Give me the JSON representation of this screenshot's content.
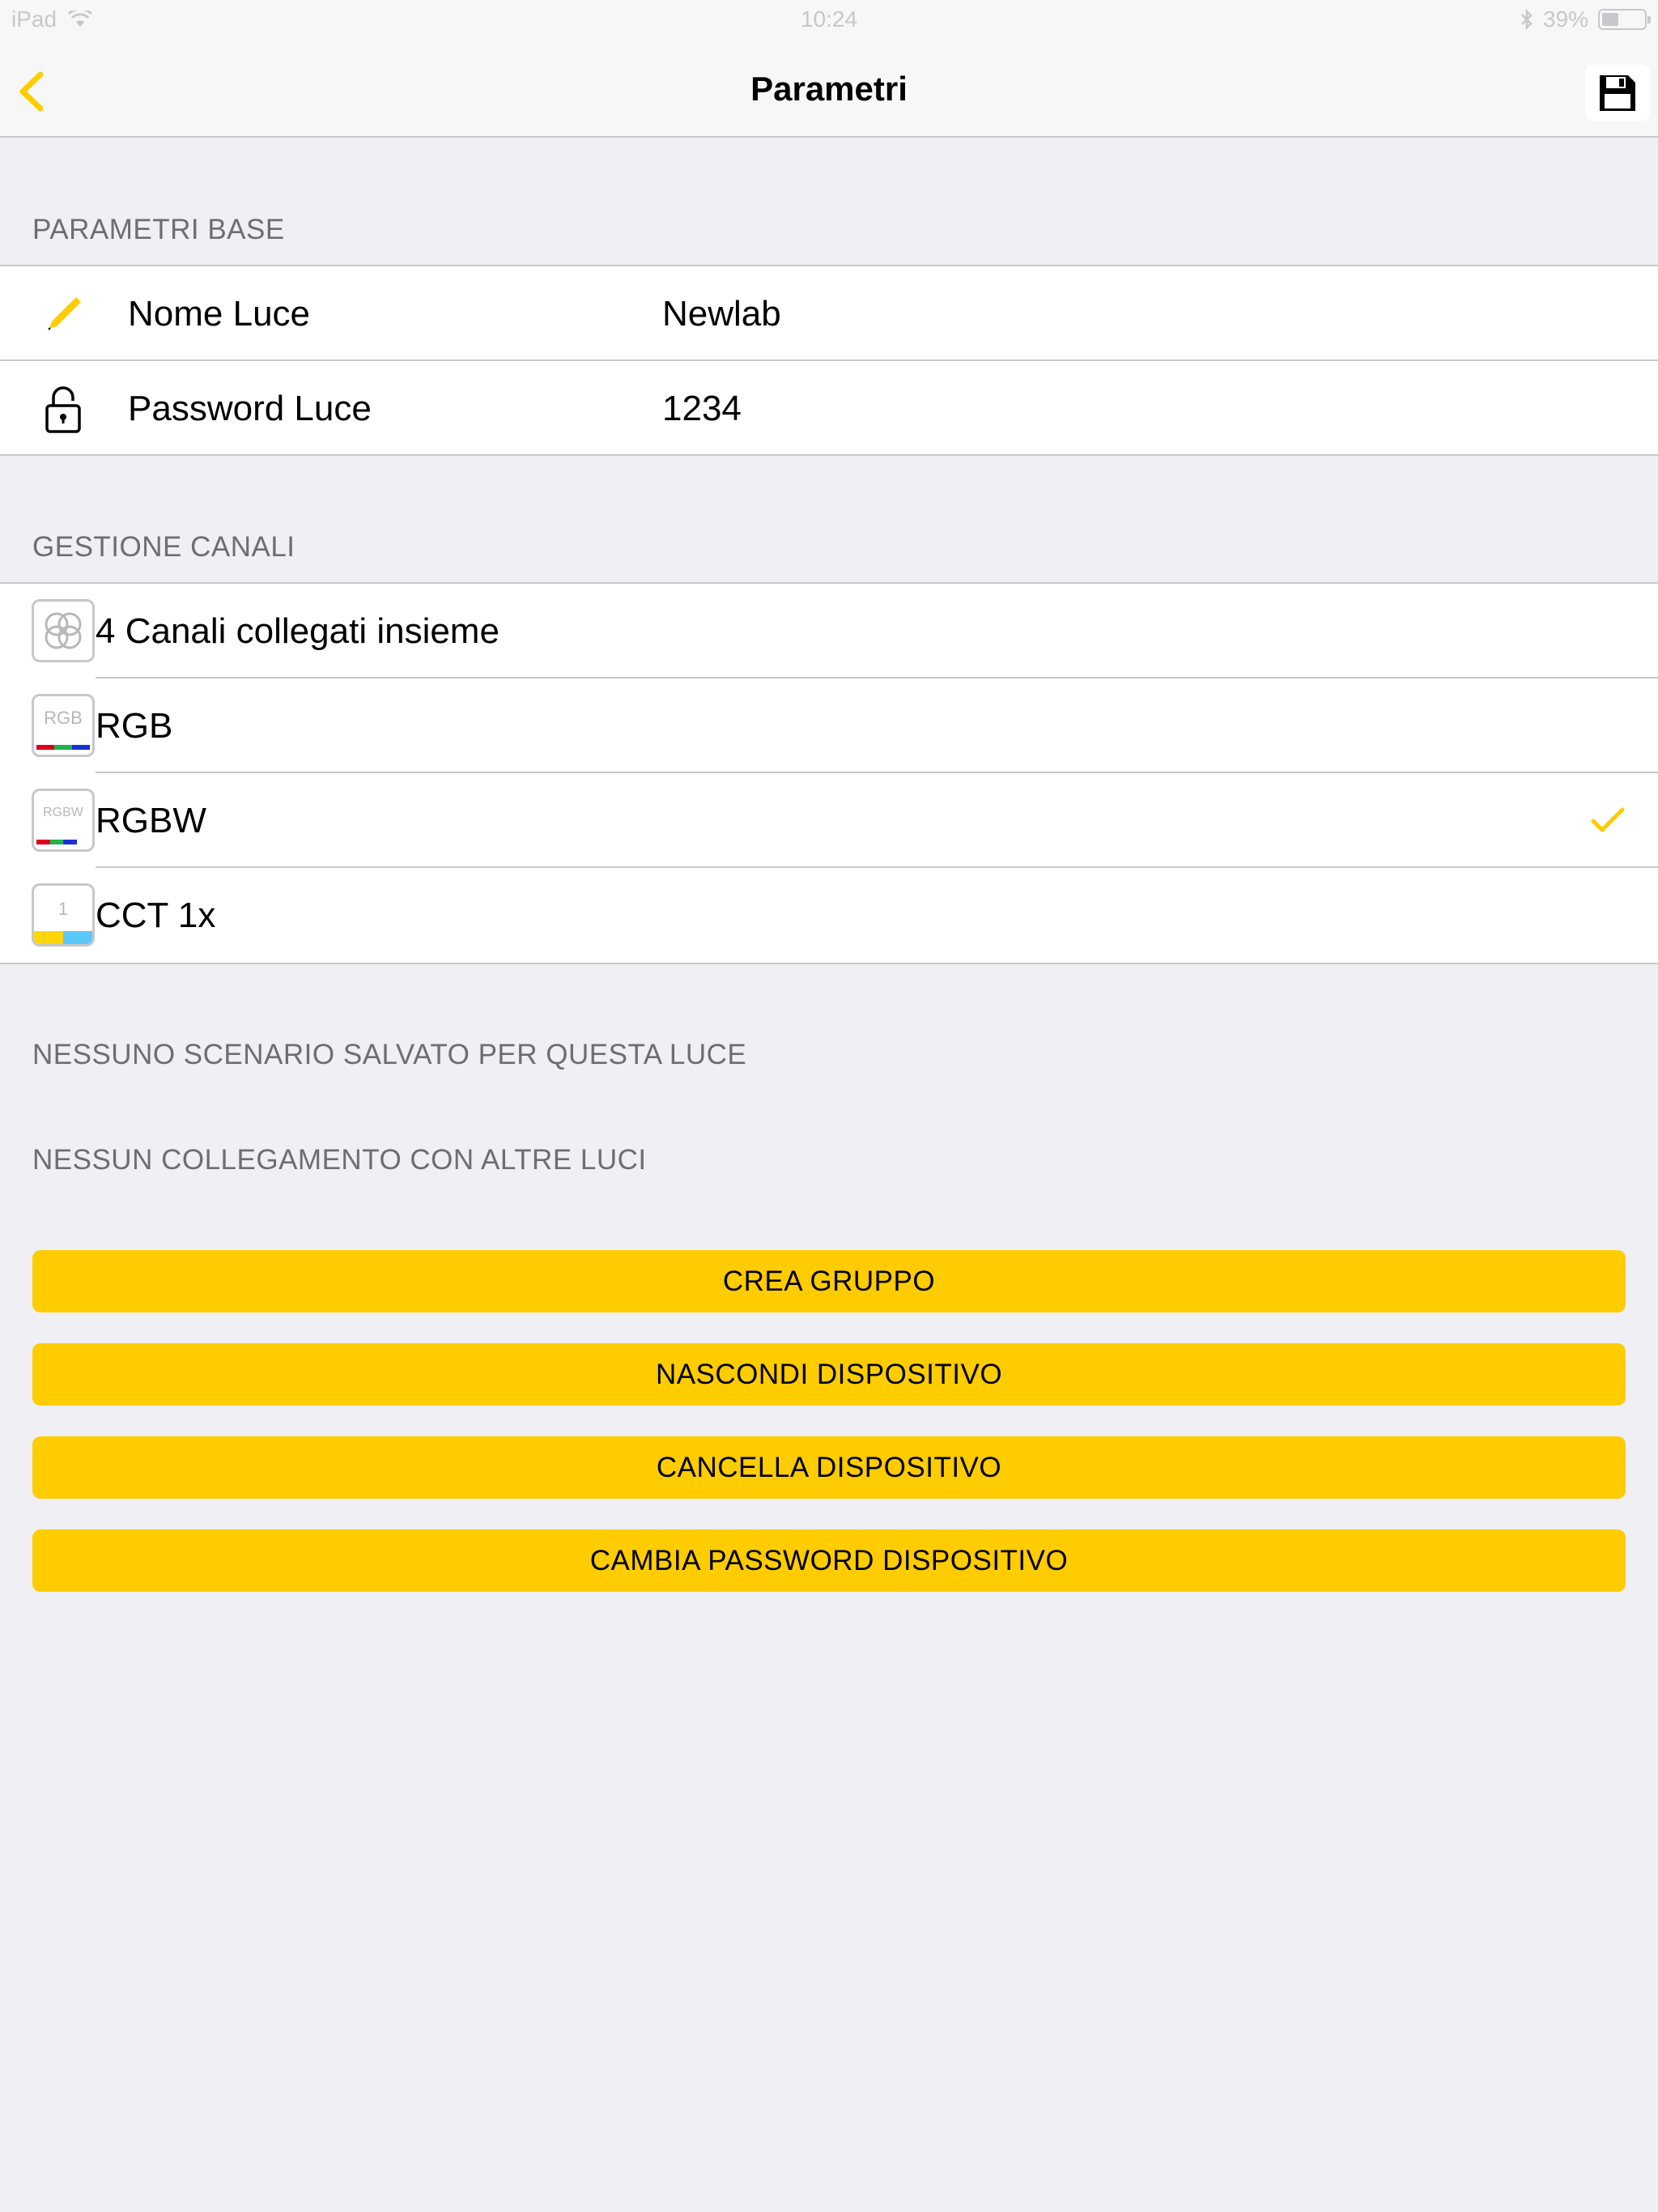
{
  "status_bar": {
    "device": "iPad",
    "time": "10:24",
    "battery_text": "39%",
    "battery_level": 0.39
  },
  "nav": {
    "title": "Parametri"
  },
  "base_params": {
    "header": "PARAMETRI BASE",
    "rows": [
      {
        "label": "Nome Luce",
        "value": "Newlab",
        "icon": "pencil-icon"
      },
      {
        "label": "Password Luce",
        "value": "1234",
        "icon": "lock-icon"
      }
    ]
  },
  "channels": {
    "header": "GESTIONE CANALI",
    "items": [
      {
        "label": "4 Canali collegati insieme",
        "icon": "linked-channels-icon",
        "selected": false
      },
      {
        "label": "RGB",
        "icon_text": "RGB",
        "icon": "rgb-icon",
        "selected": false
      },
      {
        "label": "RGBW",
        "icon_text": "RGBW",
        "icon": "rgbw-icon",
        "selected": true
      },
      {
        "label": "CCT 1x",
        "icon_text": "1",
        "icon": "cct-icon",
        "selected": false
      }
    ]
  },
  "info": {
    "no_scenario": "NESSUNO SCENARIO SALVATO PER QUESTA LUCE",
    "no_link": "NESSUN COLLEGAMENTO CON ALTRE LUCI"
  },
  "buttons": {
    "create_group": "CREA GRUPPO",
    "hide_device": "NASCONDI DISPOSITIVO",
    "delete_device": "CANCELLA DISPOSITIVO",
    "change_password": "CAMBIA PASSWORD DISPOSITIVO"
  },
  "colors": {
    "accent": "#ffcc00",
    "background": "#efeff4",
    "separator": "#c8c7cc",
    "secondary_text": "#6d6d72"
  }
}
